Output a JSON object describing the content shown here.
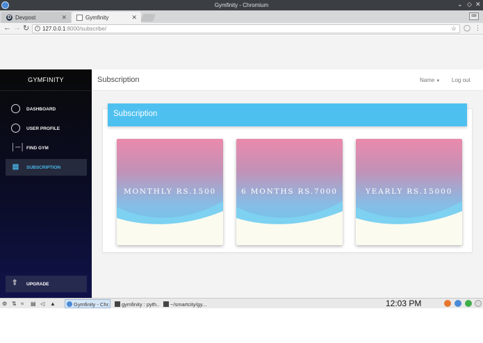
{
  "window": {
    "title": "Gymfinity - Chromium"
  },
  "tabs": [
    {
      "label": "Devpost",
      "icon": "devpost-icon",
      "icon_glyph": "D"
    },
    {
      "label": "Gymfinity",
      "icon": "page-icon"
    }
  ],
  "address": {
    "host": "127.0.0.1",
    "path": ":8000/subscribe/"
  },
  "sidebar": {
    "brand": "GYMFINITY",
    "items": [
      {
        "label": "DASHBOARD",
        "icon": "pie-chart-icon"
      },
      {
        "label": "USER PROFILE",
        "icon": "user-circle-icon"
      },
      {
        "label": "FIND GYM",
        "icon": "dumbbell-icon"
      },
      {
        "label": "SUBSCRIPTION",
        "icon": "card-icon",
        "active": true
      }
    ],
    "upgrade": {
      "label": "UPGRADE",
      "icon": "rocket-icon"
    }
  },
  "header": {
    "title": "Subscription",
    "name_menu": "Name",
    "logout": "Log out"
  },
  "content": {
    "card_title": "Subscription",
    "plans": [
      {
        "label": "MONTHLY RS.1500"
      },
      {
        "label": "6 MONTHS RS.7000"
      },
      {
        "label": "YEARLY RS.15000"
      }
    ]
  },
  "taskbar": {
    "tasks": [
      {
        "label": "Gymfinity - Chr...",
        "active": true
      },
      {
        "label": "gymfinity : pyth..."
      },
      {
        "label": "~/smartcity/gy..."
      }
    ],
    "clock": "12:03 PM"
  },
  "colors": {
    "accent": "#4ec0ef",
    "active_nav_text": "#49b6e8",
    "sidebar_bg": "#0b0d2a"
  }
}
